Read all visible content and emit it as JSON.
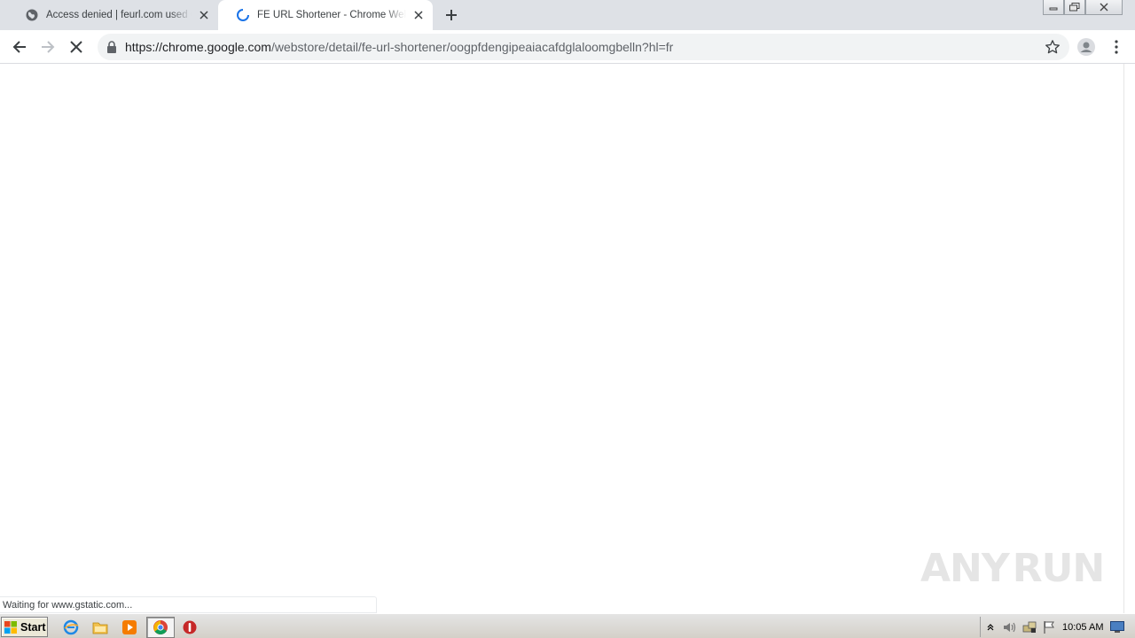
{
  "tabs": [
    {
      "title": "Access denied | feurl.com used Cloudflare to restrict access",
      "icon": "globe-icon",
      "active": false
    },
    {
      "title": "FE URL Shortener - Chrome Web Store",
      "icon": "loading-spinner-icon",
      "active": true
    }
  ],
  "toolbar": {
    "url_host": "https://chrome.google.com",
    "url_path": "/webstore/detail/fe-url-shortener/oogpfdengipeaiacafdglaloomgbelln?hl=fr"
  },
  "status": {
    "text": "Waiting for www.gstatic.com..."
  },
  "watermark": {
    "left": "ANY",
    "right": "RUN"
  },
  "taskbar": {
    "start_label": "Start",
    "clock": "10:05 AM"
  },
  "colors": {
    "tabstrip": "#dee1e6",
    "omnibox": "#f1f3f4",
    "spinner": "#1a73e8",
    "taskbar": "#d4d0c8"
  }
}
